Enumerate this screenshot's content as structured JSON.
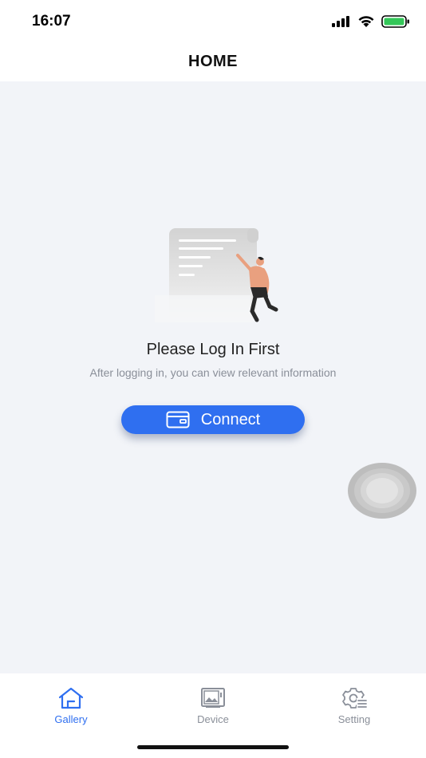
{
  "status_bar": {
    "time": "16:07",
    "icons": [
      "signal-icon",
      "wifi-icon",
      "battery-icon"
    ]
  },
  "header": {
    "title": "HOME"
  },
  "empty_state": {
    "title": "Please Log In First",
    "description": "After logging in, you can view relevant information"
  },
  "connect_button": {
    "label": "Connect",
    "icon": "wallet-icon"
  },
  "tab_bar": {
    "tabs": [
      {
        "label": "Gallery",
        "icon": "home-icon",
        "active": true
      },
      {
        "label": "Device",
        "icon": "device-icon",
        "active": false
      },
      {
        "label": "Setting",
        "icon": "settings-icon",
        "active": false
      }
    ]
  },
  "colors": {
    "accent": "#2f6ff0",
    "background": "#f2f4f8",
    "inactive": "#8a8f99",
    "battery": "#34c759"
  }
}
